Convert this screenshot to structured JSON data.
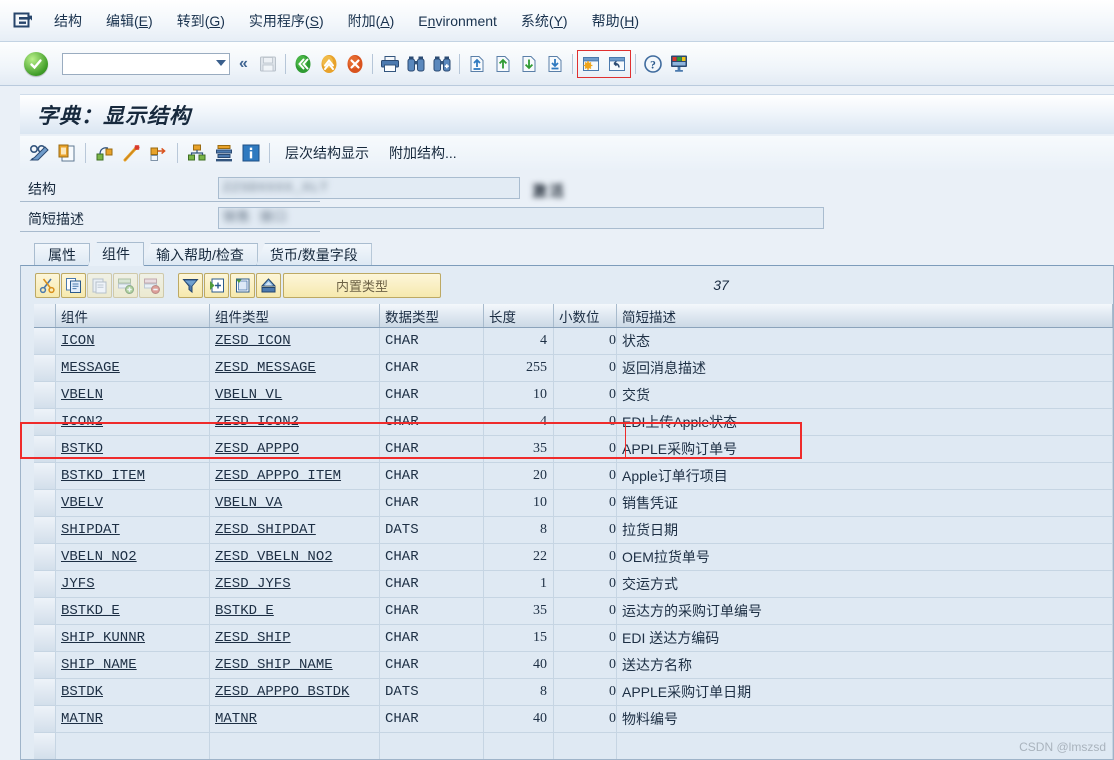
{
  "window": {
    "system_icon": "sap-system-menu-icon",
    "menu": [
      {
        "label": "结构",
        "key": ""
      },
      {
        "label": "编辑",
        "key": "E"
      },
      {
        "label": "转到",
        "key": "G"
      },
      {
        "label": "实用程序",
        "key": "S"
      },
      {
        "label": "附加",
        "key": "A"
      },
      {
        "label": "Environment",
        "key": "n"
      },
      {
        "label": "系统",
        "key": "Y"
      },
      {
        "label": "帮助",
        "key": "H"
      }
    ]
  },
  "standard_toolbar": {
    "enter_tooltip": "继续",
    "command_value": "",
    "command_placeholder": "",
    "collapse_label": "«",
    "buttons": [
      {
        "name": "save-button",
        "icon": "save-icon",
        "enabled": false
      },
      {
        "name": "back-button",
        "icon": "back-green-icon",
        "enabled": true
      },
      {
        "name": "exit-button",
        "icon": "exit-yellow-icon",
        "enabled": true
      },
      {
        "name": "cancel-button",
        "icon": "cancel-red-icon",
        "enabled": true
      },
      {
        "name": "print-button",
        "icon": "printer-icon",
        "enabled": true
      },
      {
        "name": "find-button",
        "icon": "binoculars-icon",
        "enabled": true
      },
      {
        "name": "find-next-button",
        "icon": "binoculars-plus-icon",
        "enabled": true
      },
      {
        "name": "first-page-button",
        "icon": "page-first-icon",
        "enabled": true
      },
      {
        "name": "previous-page-button",
        "icon": "page-up-icon",
        "enabled": true
      },
      {
        "name": "next-page-button",
        "icon": "page-down-icon",
        "enabled": true
      },
      {
        "name": "last-page-button",
        "icon": "page-last-icon",
        "enabled": true
      },
      {
        "name": "create-session-button",
        "icon": "new-session-icon",
        "enabled": true
      },
      {
        "name": "create-shortcut-button",
        "icon": "shortcut-icon",
        "enabled": true
      },
      {
        "name": "help-button",
        "icon": "help-question-icon",
        "enabled": true
      },
      {
        "name": "layout-menu-button",
        "icon": "customize-layout-icon",
        "enabled": true
      }
    ]
  },
  "title": "字典：显示结构",
  "app_toolbar": {
    "icons": [
      {
        "name": "display-change-button",
        "icon": "glasses-pencil-icon"
      },
      {
        "name": "check-button",
        "icon": "clipboard-check-icon"
      },
      {
        "name": "activate-button",
        "icon": "activate-icon"
      },
      {
        "name": "generate-button",
        "icon": "wand-icon"
      },
      {
        "name": "where-used-button",
        "icon": "where-used-list-icon"
      },
      {
        "name": "hierarchy-button",
        "icon": "hierarchy-icon"
      },
      {
        "name": "expand-button",
        "icon": "expand-stack-icon"
      },
      {
        "name": "info-button",
        "icon": "information-icon"
      }
    ],
    "text_buttons": [
      {
        "name": "hierarchy-display-button",
        "label": "层次结构显示"
      },
      {
        "name": "append-structure-button",
        "label": "附加结构..."
      }
    ]
  },
  "form": {
    "structure_label": "结构",
    "structure_value_masked": "ZZSDXXXX_XLT",
    "structure_suffix_masked": "激活",
    "description_label": "简短描述",
    "description_value_masked": "销售 接口"
  },
  "tabs": [
    {
      "label": "属性",
      "active": false,
      "name": "tab-attributes"
    },
    {
      "label": "组件",
      "active": true,
      "name": "tab-components"
    },
    {
      "label": "输入帮助/检查",
      "active": false,
      "name": "tab-entry-help"
    },
    {
      "label": "货币/数量字段",
      "active": false,
      "name": "tab-currency-quantity"
    }
  ],
  "table_toolbar": {
    "buttons": [
      {
        "name": "cut-button",
        "icon": "scissors-icon",
        "enabled": true
      },
      {
        "name": "copy-button",
        "icon": "copy-icon",
        "enabled": true
      },
      {
        "name": "paste-button",
        "icon": "paste-icon",
        "enabled": false
      },
      {
        "name": "insert-row-button",
        "icon": "insert-row-icon",
        "enabled": false
      },
      {
        "name": "delete-row-button",
        "icon": "delete-row-icon",
        "enabled": false
      },
      {
        "name": "filter-button",
        "icon": "filter-funnel-icon",
        "enabled": true
      },
      {
        "name": "append-row-button",
        "icon": "append-row-icon",
        "enabled": true
      },
      {
        "name": "predefined-type-button",
        "icon": "predefined-type-icon",
        "enabled": true
      },
      {
        "name": "data-element-button",
        "icon": "data-element-icon",
        "enabled": true
      }
    ],
    "builtin_type_label": "内置类型",
    "row_count": "37"
  },
  "grid": {
    "columns": [
      {
        "label": "组件",
        "name": "column-component"
      },
      {
        "label": "组件类型",
        "name": "column-component-type"
      },
      {
        "label": "数据类型",
        "name": "column-data-type"
      },
      {
        "label": "长度",
        "name": "column-length"
      },
      {
        "label": "小数位",
        "name": "column-decimals"
      },
      {
        "label": "简短描述",
        "name": "column-short-description"
      }
    ],
    "rows": [
      {
        "component": "ICON",
        "type": "ZESD_ICON",
        "data_type": "CHAR",
        "length": "4",
        "decimals": "0",
        "description": "状态"
      },
      {
        "component": "MESSAGE",
        "type": "ZESD_MESSAGE",
        "data_type": "CHAR",
        "length": "255",
        "decimals": "0",
        "description": "返回消息描述"
      },
      {
        "component": "VBELN",
        "type": "VBELN_VL",
        "data_type": "CHAR",
        "length": "10",
        "decimals": "0",
        "description": "交货"
      },
      {
        "component": "ICON2",
        "type": "ZESD_ICON2",
        "data_type": "CHAR",
        "length": "4",
        "decimals": "0",
        "description": "EDI上传Apple状态"
      },
      {
        "component": "BSTKD",
        "type": "ZESD_APPPO",
        "data_type": "CHAR",
        "length": "35",
        "decimals": "0",
        "description": "APPLE采购订单号"
      },
      {
        "component": "BSTKD_ITEM",
        "type": "ZESD_APPPO_ITEM",
        "data_type": "CHAR",
        "length": "20",
        "decimals": "0",
        "description": "Apple订单行项目"
      },
      {
        "component": "VBELV",
        "type": "VBELN_VA",
        "data_type": "CHAR",
        "length": "10",
        "decimals": "0",
        "description": "销售凭证"
      },
      {
        "component": "SHIPDAT",
        "type": "ZESD_SHIPDAT",
        "data_type": "DATS",
        "length": "8",
        "decimals": "0",
        "description": "拉货日期"
      },
      {
        "component": "VBELN_NO2",
        "type": "ZESD_VBELN_NO2",
        "data_type": "CHAR",
        "length": "22",
        "decimals": "0",
        "description": "OEM拉货单号"
      },
      {
        "component": "JYFS",
        "type": "ZESD_JYFS",
        "data_type": "CHAR",
        "length": "1",
        "decimals": "0",
        "description": "交运方式"
      },
      {
        "component": "BSTKD_E",
        "type": "BSTKD_E",
        "data_type": "CHAR",
        "length": "35",
        "decimals": "0",
        "description": "运达方的采购订单编号"
      },
      {
        "component": "SHIP_KUNNR",
        "type": "ZESD_SHIP",
        "data_type": "CHAR",
        "length": "15",
        "decimals": "0",
        "description": "EDI 送达方编码"
      },
      {
        "component": "SHIP_NAME",
        "type": "ZESD_SHIP_NAME",
        "data_type": "CHAR",
        "length": "40",
        "decimals": "0",
        "description": "送达方名称"
      },
      {
        "component": "BSTDK",
        "type": "ZESD_APPPO_BSTDK",
        "data_type": "DATS",
        "length": "8",
        "decimals": "0",
        "description": "APPLE采购订单日期"
      },
      {
        "component": "MATNR",
        "type": "MATNR",
        "data_type": "CHAR",
        "length": "40",
        "decimals": "0",
        "description": "物料编号"
      }
    ],
    "annotation": {
      "name": "red-highlight-rectangle",
      "color": "#ef2b2b",
      "target_row": "ICON2"
    }
  },
  "watermark": "CSDN @lmszsd",
  "colors": {
    "accent": "#1d2f44",
    "panel_bg": "#e2ebf4",
    "row_bg": "#dfe9f3",
    "toolbar_yellow": "#f6e9ae",
    "annotation_red": "#ef2b2b"
  }
}
